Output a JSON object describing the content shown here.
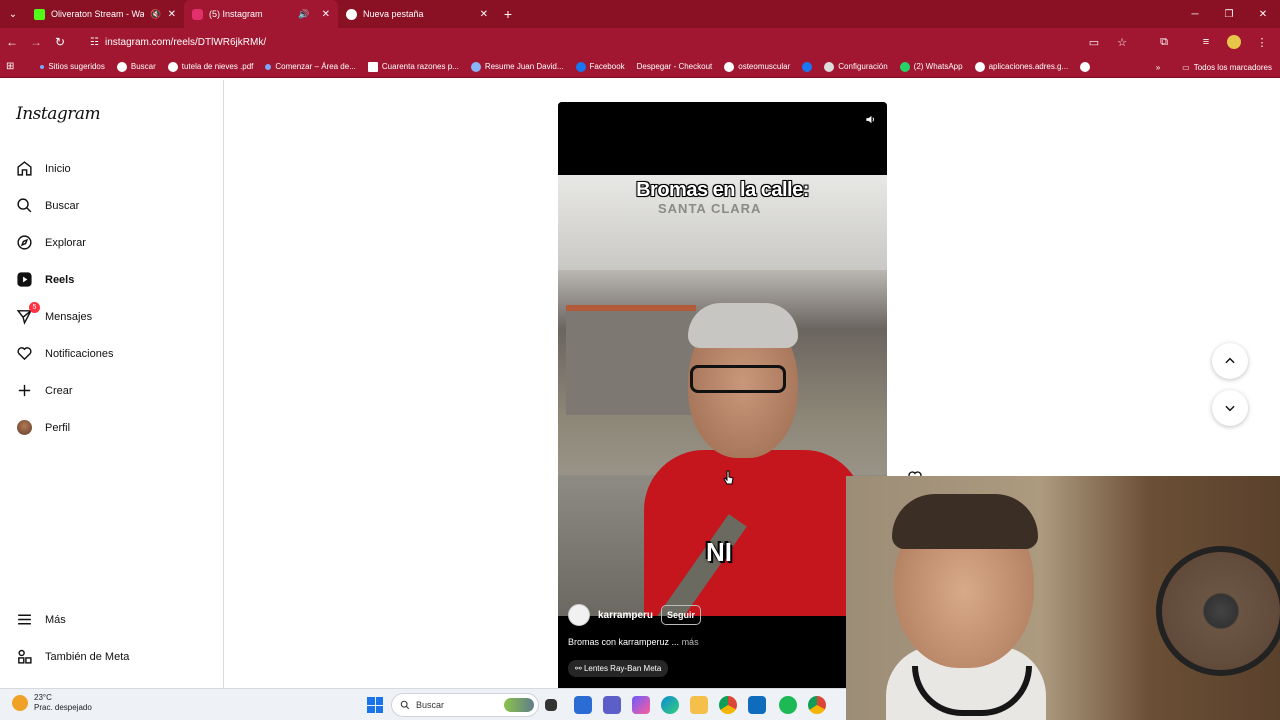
{
  "browser": {
    "tabs": [
      {
        "title": "Oliveraton Stream - Watch L",
        "favicon_color": "#53fc18",
        "muted": true,
        "active": false
      },
      {
        "title": "(5) Instagram",
        "favicon_color": "#e1306c",
        "muted": false,
        "audio": true,
        "active": true
      },
      {
        "title": "Nueva pestaña",
        "favicon_color": "#ffffff",
        "active": false
      }
    ],
    "url": "instagram.com/reels/DTlWR6jkRMk/",
    "bookmarks": [
      "Sitios sugeridos",
      "Buscar",
      "tutela de nieves .pdf",
      "Comenzar – Área de...",
      "Cuarenta razones p...",
      "Resume Juan David...",
      "Facebook",
      "Despegar - Checkout",
      "osteomuscular",
      "Configuración",
      "(2) WhatsApp",
      "aplicaciones.adres.g..."
    ],
    "all_bookmarks": "Todos los marcadores",
    "accent": "#a11630"
  },
  "instagram": {
    "logo": "Instagram",
    "nav": [
      {
        "label": "Inicio",
        "icon": "home-icon"
      },
      {
        "label": "Buscar",
        "icon": "search-icon"
      },
      {
        "label": "Explorar",
        "icon": "compass-icon"
      },
      {
        "label": "Reels",
        "icon": "reels-icon"
      },
      {
        "label": "Mensajes",
        "icon": "messenger-icon",
        "badge": "5"
      },
      {
        "label": "Notificaciones",
        "icon": "heart-icon"
      },
      {
        "label": "Crear",
        "icon": "plus-icon"
      },
      {
        "label": "Perfil",
        "icon": "avatar"
      }
    ],
    "more": "Más",
    "meta": "También de Meta"
  },
  "reel": {
    "overlay_title": "Bromas en la calle:",
    "sign_text": "SANTA CLARA",
    "subtitle_word": "NI",
    "author": "karramperu",
    "follow_label": "Seguir",
    "caption": "Bromas con karramperuz ...",
    "more": "más",
    "music": "Lentes Ray-Ban Meta"
  },
  "taskbar": {
    "temperature": "23°C",
    "weather": "Prac. despejado",
    "search_placeholder": "Buscar"
  }
}
